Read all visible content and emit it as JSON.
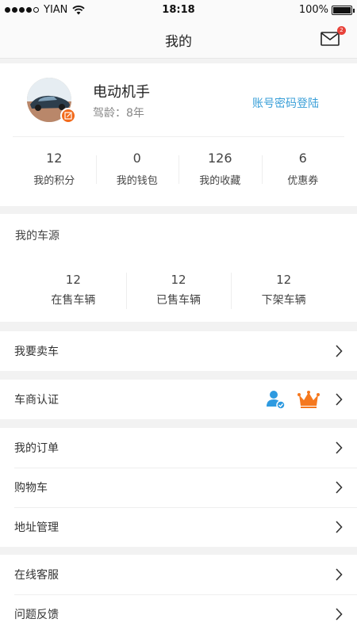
{
  "status_bar": {
    "carrier": "YIAN",
    "time": "18:18",
    "battery": "100%"
  },
  "nav": {
    "title": "我的",
    "mail_badge": "2"
  },
  "profile": {
    "name": "电动机手",
    "drive_age": "驾龄：8年",
    "login_link": "账号密码登陆",
    "stats": [
      {
        "value": "12",
        "label": "我的积分"
      },
      {
        "value": "0",
        "label": "我的钱包"
      },
      {
        "value": "126",
        "label": "我的收藏"
      },
      {
        "value": "6",
        "label": "优惠券"
      }
    ]
  },
  "car_source": {
    "title": "我的车源",
    "stats": [
      {
        "value": "12",
        "label": "在售车辆"
      },
      {
        "value": "12",
        "label": "已售车辆"
      },
      {
        "value": "12",
        "label": "下架车辆"
      }
    ]
  },
  "menu": {
    "sell_car": "我要卖车",
    "dealer_cert": "车商认证",
    "orders": "我的订单",
    "cart": "购物车",
    "address": "地址管理",
    "service": "在线客服",
    "feedback": "问题反馈"
  },
  "colors": {
    "accent_blue": "#3a9fd8",
    "accent_orange": "#f26a1b",
    "badge_red": "#e8423a"
  }
}
